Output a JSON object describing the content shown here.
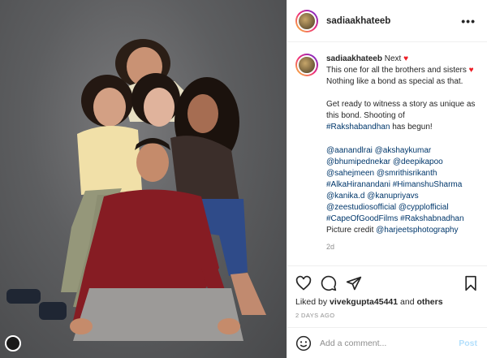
{
  "post": {
    "username": "sadiaakhateeb",
    "more_label": "•••",
    "caption": {
      "username": "sadiaakhateeb",
      "line1": "Next",
      "line2": "This one for all the brothers and sisters",
      "line3": "Nothing like a bond as special as that.",
      "line4": "Get ready to witness a story as unique as this bond. Shooting of",
      "hashtag1": "#Rakshabandhan",
      "line4b": "has begun!",
      "mentions": [
        "@aanandlrai @akshaykumar",
        "@bhumipednekar @deepikapoo",
        "@sahejmeen @smrithisrikanth",
        "#AlkaHiranandani #HimanshuSharma",
        "@kanika.d @kanupriyavs",
        "@zeestudiosofficial @cypplofficial",
        "#CapeOfGoodFilms #Rakshabnadhan"
      ],
      "credit_prefix": "Picture credit",
      "credit_handle": "@harjeetsphotography",
      "time": "2d"
    },
    "likes": {
      "prefix": "Liked by",
      "user": "vivekgupta45441",
      "middle": "and",
      "others": "others"
    },
    "date": "2 DAYS AGO",
    "comment": {
      "placeholder": "Add a comment...",
      "post_label": "Post"
    },
    "icons": [
      "heart-icon",
      "comment-icon",
      "share-icon",
      "bookmark-icon",
      "emoji-icon",
      "more-icon"
    ],
    "colors": {
      "link": "#00376b",
      "heart": "#ed1c24",
      "post_disabled": "#b2dffc",
      "muted": "#8e8e8e"
    }
  }
}
